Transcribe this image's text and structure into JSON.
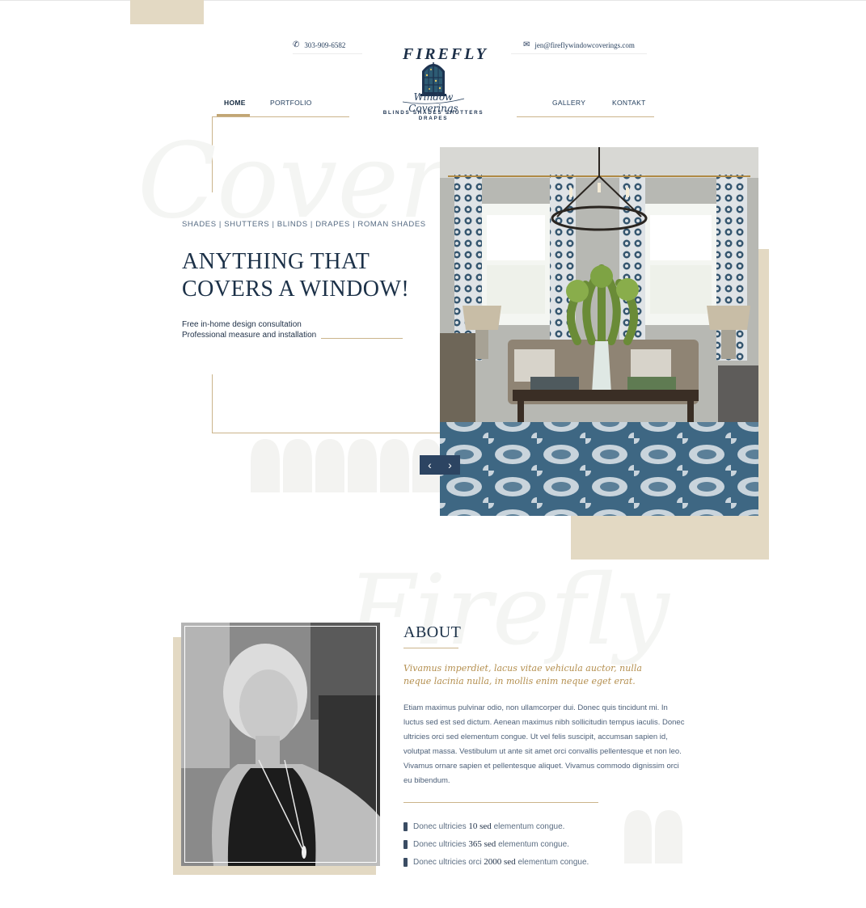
{
  "header": {
    "phone": "303-909-6582",
    "email": "jen@fireflywindowcoverings.com",
    "logo": {
      "name": "FIREFLY",
      "script": "Window Coverings",
      "tagline": "BLINDS SHADES SHUTTERS DRAPES"
    },
    "nav_left": [
      {
        "label": "HOME",
        "active": true
      },
      {
        "label": "PORTFOLIO",
        "active": false
      }
    ],
    "nav_right": [
      {
        "label": "GALLERY",
        "active": false
      },
      {
        "label": "KONTAKT",
        "active": false
      }
    ]
  },
  "hero": {
    "ghost_word": "Covers",
    "categories": "SHADES | SHUTTERS | BLINDS | DRAPES | ROMAN SHADES",
    "headline_line1": "ANYTHING THAT",
    "headline_line2": "COVERS A WINDOW!",
    "features": [
      "Free in-home design consultation",
      "Professional measure and installation"
    ],
    "slider": {
      "prev_icon": "chevron-left-icon",
      "next_icon": "chevron-right-icon",
      "prev_glyph": "‹",
      "next_glyph": "›"
    }
  },
  "about": {
    "ghost_word": "Firefly",
    "title": "ABOUT",
    "quote": "Vivamus imperdiet, lacus vitae vehicula auctor, nulla neque lacinia nulla, in mollis enim neque eget erat.",
    "body": "Etiam maximus pulvinar odio, non ullamcorper dui. Donec quis tincidunt mi. In luctus sed est sed dictum. Aenean maximus nibh sollicitudin tempus iaculis. Donec ultricies orci sed elementum congue. Ut vel felis suscipit, accumsan sapien id, volutpat massa. Vestibulum ut ante sit amet orci convallis pellentesque et non leo. Vivamus ornare sapien et pellentesque aliquet. Vivamus commodo dignissim orci eu bibendum.",
    "bullets": [
      {
        "pre": "Donec ultricies",
        "num": "10 sed",
        "post": "elementum congue."
      },
      {
        "pre": "Donec ultricies",
        "num": "365 sed",
        "post": "elementum congue."
      },
      {
        "pre": "Donec ultricies orci",
        "num": "2000 sed",
        "post": "elementum congue."
      }
    ]
  },
  "colors": {
    "navy": "#1c3148",
    "gold": "#c2a675",
    "beige": "#e3d9c3",
    "slider_button": "#2c4462"
  }
}
